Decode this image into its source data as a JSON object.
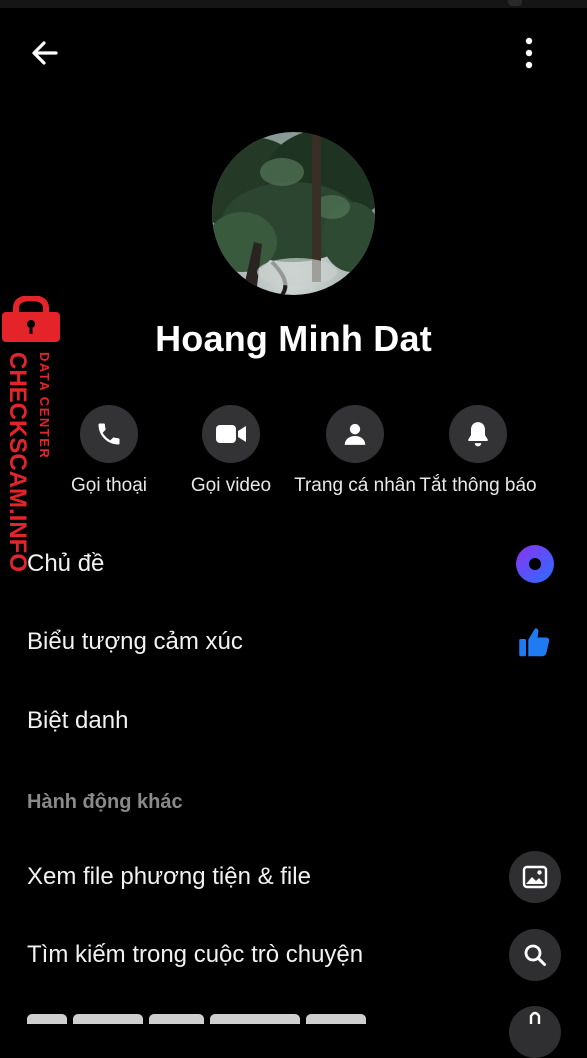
{
  "profile": {
    "name": "Hoang Minh Dat"
  },
  "actions": [
    {
      "label": "Gọi thoại",
      "icon": "phone-icon"
    },
    {
      "label": "Gọi video",
      "icon": "video-camera-icon"
    },
    {
      "label": "Trang cá nhân",
      "icon": "person-icon"
    },
    {
      "label": "Tắt thông báo",
      "icon": "bell-icon"
    }
  ],
  "settings": {
    "theme": "Chủ đề",
    "emoji": "Biểu tượng cảm xúc",
    "nickname": "Biệt danh"
  },
  "more_actions": {
    "title": "Hành động khác",
    "media": "Xem file phương tiện & file",
    "search": "Tìm kiếm trong cuộc trò chuyện"
  },
  "watermark": {
    "line1": "DATA CENTER",
    "line2": "CHECKSCAM.INFO"
  },
  "colors": {
    "background": "#000000",
    "theme_gradient_start": "#7b3df0",
    "theme_gradient_end": "#2f6bff",
    "like_blue": "#1f7bf2",
    "watermark_red": "#e5242a"
  }
}
